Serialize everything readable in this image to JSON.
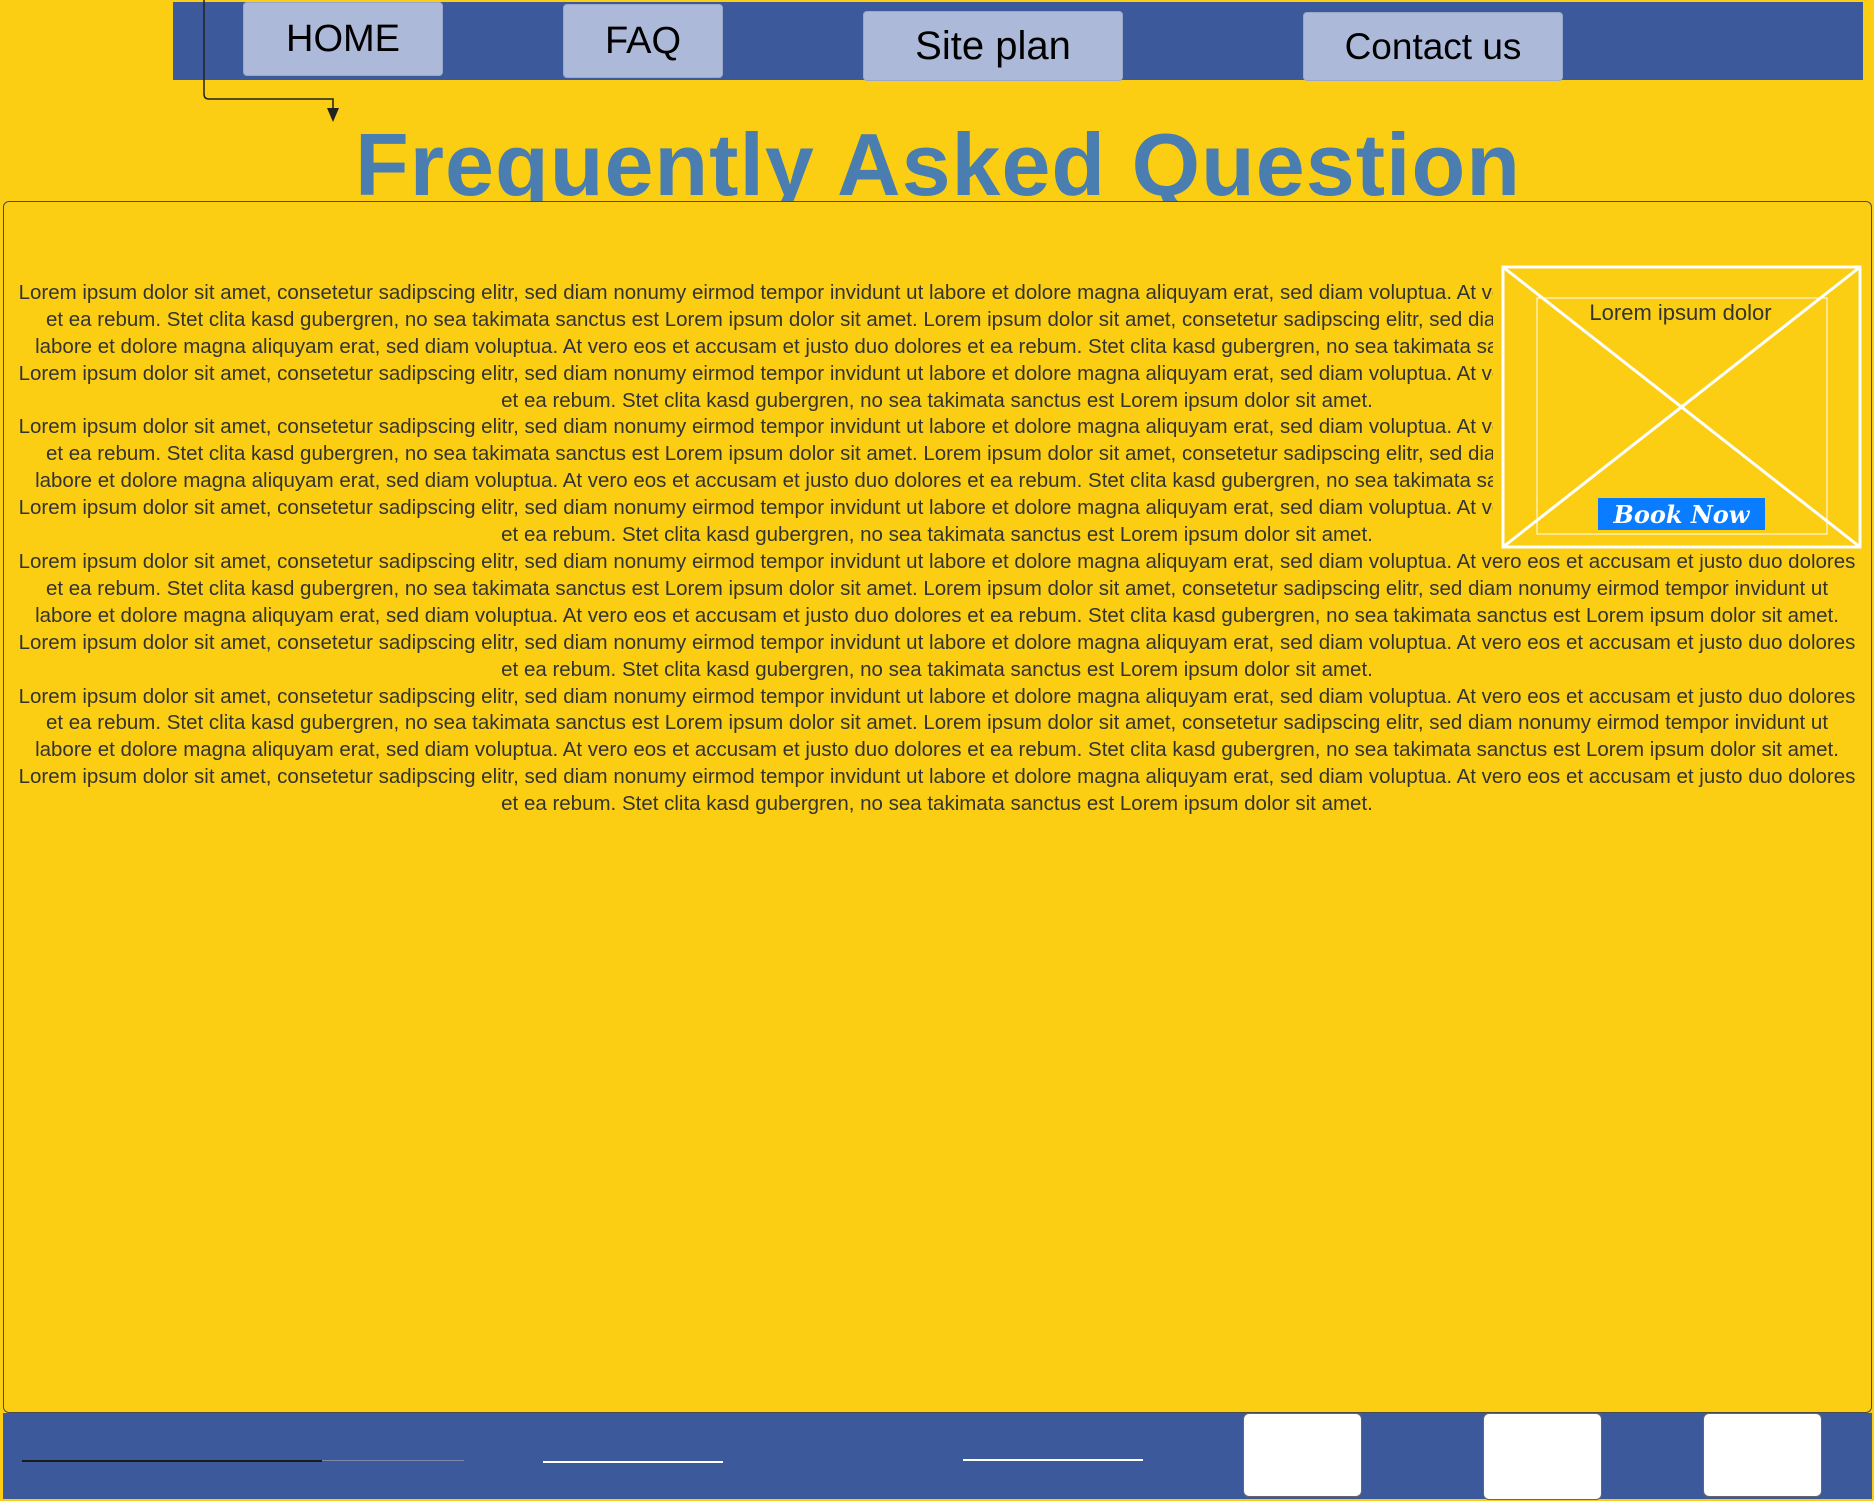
{
  "nav": {
    "items": [
      {
        "label": "HOME"
      },
      {
        "label": "FAQ"
      },
      {
        "label": "Site plan"
      },
      {
        "label": "Contact us"
      }
    ]
  },
  "main": {
    "title": "Frequently Asked Questions",
    "paragraphs": [
      "Lorem ipsum dolor sit amet, consetetur sadipscing elitr, sed diam nonumy eirmod tempor invidunt ut labore et dolore magna aliquyam erat, sed diam voluptua. At vero eos et accusam et justo duo dolores et ea rebum. Stet clita kasd gubergren, no sea takimata sanctus est Lorem ipsum dolor sit amet. Lorem ipsum dolor sit amet, consetetur sadipscing elitr, sed diam nonumy eirmod tempor invidunt ut labore et dolore magna aliquyam erat, sed diam voluptua. At vero eos et accusam et justo duo dolores et ea rebum. Stet clita kasd gubergren, no sea takimata sanctus est Lorem ipsum dolor sit amet. Lorem ipsum dolor sit amet, consetetur sadipscing elitr, sed diam nonumy eirmod tempor invidunt ut labore et dolore magna aliquyam erat, sed diam voluptua. At vero eos et accusam et justo duo dolores et ea rebum. Stet clita kasd gubergren, no sea takimata sanctus est Lorem ipsum dolor sit amet.",
      "Lorem ipsum dolor sit amet, consetetur sadipscing elitr, sed diam nonumy eirmod tempor invidunt ut labore et dolore magna aliquyam erat, sed diam voluptua. At vero eos et accusam et justo duo dolores et ea rebum. Stet clita kasd gubergren, no sea takimata sanctus est Lorem ipsum dolor sit amet. Lorem ipsum dolor sit amet, consetetur sadipscing elitr, sed diam nonumy eirmod tempor invidunt ut labore et dolore magna aliquyam erat, sed diam voluptua. At vero eos et accusam et justo duo dolores et ea rebum. Stet clita kasd gubergren, no sea takimata sanctus est Lorem ipsum dolor sit amet. Lorem ipsum dolor sit amet, consetetur sadipscing elitr, sed diam nonumy eirmod tempor invidunt ut labore et dolore magna aliquyam erat, sed diam voluptua. At vero eos et accusam et justo duo dolores et ea rebum. Stet clita kasd gubergren, no sea takimata sanctus est Lorem ipsum dolor sit amet.",
      "Lorem ipsum dolor sit amet, consetetur sadipscing elitr, sed diam nonumy eirmod tempor invidunt ut labore et dolore magna aliquyam erat, sed diam voluptua. At vero eos et accusam et justo duo dolores et ea rebum. Stet clita kasd gubergren, no sea takimata sanctus est Lorem ipsum dolor sit amet. Lorem ipsum dolor sit amet, consetetur sadipscing elitr, sed diam nonumy eirmod tempor invidunt ut labore et dolore magna aliquyam erat, sed diam voluptua. At vero eos et accusam et justo duo dolores et ea rebum. Stet clita kasd gubergren, no sea takimata sanctus est Lorem ipsum dolor sit amet. Lorem ipsum dolor sit amet, consetetur sadipscing elitr, sed diam nonumy eirmod tempor invidunt ut labore et dolore magna aliquyam erat, sed diam voluptua. At vero eos et accusam et justo duo dolores et ea rebum. Stet clita kasd gubergren, no sea takimata sanctus est Lorem ipsum dolor sit amet.",
      "Lorem ipsum dolor sit amet, consetetur sadipscing elitr, sed diam nonumy eirmod tempor invidunt ut labore et dolore magna aliquyam erat, sed diam voluptua. At vero eos et accusam et justo duo dolores et ea rebum. Stet clita kasd gubergren, no sea takimata sanctus est Lorem ipsum dolor sit amet. Lorem ipsum dolor sit amet, consetetur sadipscing elitr, sed diam nonumy eirmod tempor invidunt ut labore et dolore magna aliquyam erat, sed diam voluptua. At vero eos et accusam et justo duo dolores et ea rebum. Stet clita kasd gubergren, no sea takimata sanctus est Lorem ipsum dolor sit amet. Lorem ipsum dolor sit amet, consetetur sadipscing elitr, sed diam nonumy eirmod tempor invidunt ut labore et dolore magna aliquyam erat, sed diam voluptua. At vero eos et accusam et justo duo dolores et ea rebum. Stet clita kasd gubergren, no sea takimata sanctus est Lorem ipsum dolor sit amet."
    ]
  },
  "ad": {
    "title": "Lorem ipsum dolor",
    "button_label": "Book Now"
  },
  "colors": {
    "background": "#fbce14",
    "nav_bar": "#3c5a9b",
    "nav_button": "#adb9d8",
    "title": "#4a7eb1",
    "book_button": "#0a7cff"
  }
}
